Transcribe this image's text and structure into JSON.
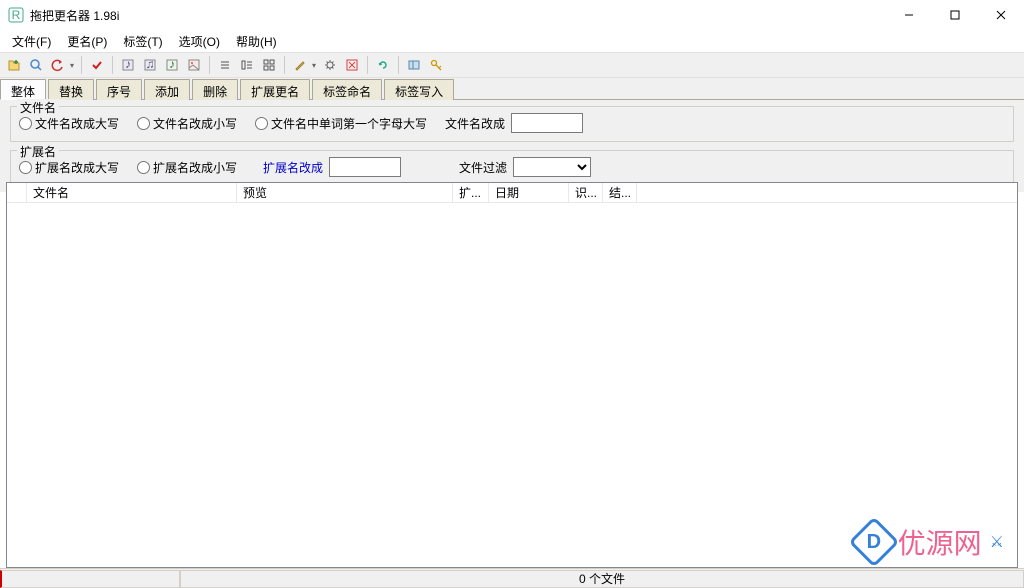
{
  "window": {
    "title": "拖把更名器 1.98i"
  },
  "menu": {
    "file": "文件(F)",
    "rename": "更名(P)",
    "tags": "标签(T)",
    "options": "选项(O)",
    "help": "帮助(H)"
  },
  "tabs": [
    "整体",
    "替换",
    "序号",
    "添加",
    "删除",
    "扩展更名",
    "标签命名",
    "标签写入"
  ],
  "filename_group": {
    "legend": "文件名",
    "r_upper": "文件名改成大写",
    "r_lower": "文件名改成小写",
    "r_titlecase": "文件名中单词第一个字母大写",
    "set_label": "文件名改成",
    "set_value": ""
  },
  "ext_group": {
    "legend": "扩展名",
    "r_upper": "扩展名改成大写",
    "r_lower": "扩展名改成小写",
    "set_label": "扩展名改成",
    "set_value": "",
    "filter_label": "文件过滤",
    "filter_value": ""
  },
  "columns": {
    "c1": "文件名",
    "c2": "预览",
    "c3": "扩...",
    "c4": "日期",
    "c5": "识...",
    "c6": "结..."
  },
  "status": {
    "center": "0 个文件"
  },
  "watermark": {
    "d": "D",
    "text": "优源网",
    "xx": "⚔"
  }
}
